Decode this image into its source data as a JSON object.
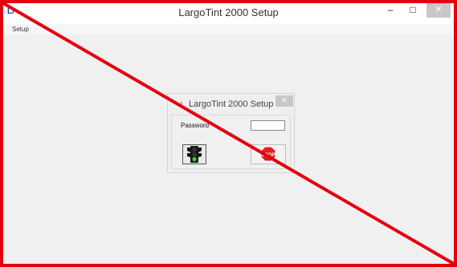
{
  "app": {
    "title": "LargoTint 2000 Setup",
    "icon": "largotint-app-icon",
    "icon_glyph": "L/",
    "minimize_glyph": "–",
    "maximize_glyph": "□",
    "close_glyph": "✕"
  },
  "menu": {
    "items": [
      {
        "label": "Setup"
      }
    ]
  },
  "dialog": {
    "title": "LargoTint 2000 Setup",
    "icon": "lock-icon",
    "icon_glyph": "⚷",
    "close_glyph": "✕",
    "password_label": "Password",
    "password_value": "",
    "go_button_icon": "traffic-light-icon",
    "stop_button_icon": "stop-sign-icon",
    "stop_sign_text": "STOP"
  },
  "colors": {
    "overlay_red": "#e5000d",
    "close_gray": "#c7c7c7",
    "app_icon_blue": "#1d3fa8"
  }
}
